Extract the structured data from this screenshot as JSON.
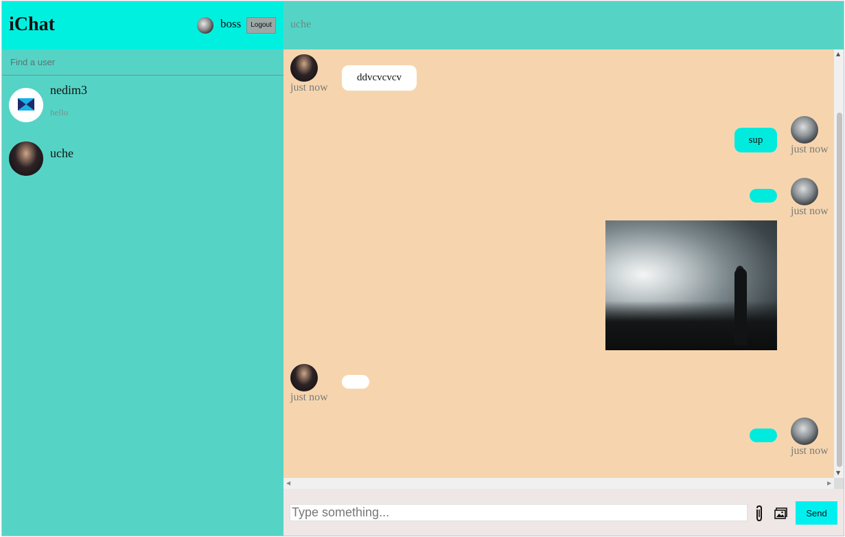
{
  "sidebar": {
    "app_title": "iChat",
    "current_user": "boss",
    "logout_label": "Logout",
    "search_placeholder": "Find a user",
    "contacts": [
      {
        "name": "nedim3",
        "last_message": "hello",
        "avatar": "logo"
      },
      {
        "name": "uche",
        "last_message": "",
        "avatar": "photo-man"
      }
    ]
  },
  "chat": {
    "with_user": "uche",
    "messages": [
      {
        "direction": "incoming",
        "text": "ddvcvcvcv",
        "time": "just now"
      },
      {
        "direction": "outgoing",
        "text": "sup",
        "time": "just now"
      },
      {
        "direction": "outgoing",
        "text": "",
        "time": "just now",
        "attachment": "image-cloudy-sky"
      },
      {
        "direction": "incoming",
        "text": "",
        "time": "just now"
      },
      {
        "direction": "outgoing",
        "text": "",
        "time": "just now"
      }
    ],
    "composer_placeholder": "Type something...",
    "send_label": "Send",
    "icons": {
      "attach": "paperclip-icon",
      "image": "image-icon"
    }
  },
  "colors": {
    "header_accent": "#00f0e0",
    "sidebar_bg": "#55d4c6",
    "messages_bg": "#f6d5ae",
    "outgoing_bubble": "#00ebdd",
    "incoming_bubble": "#ffffff"
  }
}
